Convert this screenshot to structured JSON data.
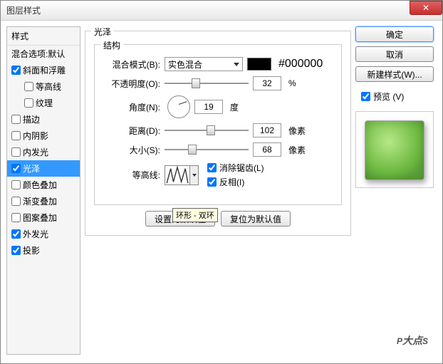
{
  "window": {
    "title": "图层样式"
  },
  "sidebar": {
    "header": "样式",
    "blendOptions": "混合选项:默认",
    "items": [
      {
        "label": "斜面和浮雕",
        "checked": true,
        "indent": false
      },
      {
        "label": "等高线",
        "checked": false,
        "indent": true
      },
      {
        "label": "纹理",
        "checked": false,
        "indent": true
      },
      {
        "label": "描边",
        "checked": false,
        "indent": false
      },
      {
        "label": "内阴影",
        "checked": false,
        "indent": false
      },
      {
        "label": "内发光",
        "checked": false,
        "indent": false
      },
      {
        "label": "光泽",
        "checked": true,
        "indent": false,
        "selected": true
      },
      {
        "label": "颜色叠加",
        "checked": false,
        "indent": false
      },
      {
        "label": "渐变叠加",
        "checked": false,
        "indent": false
      },
      {
        "label": "图案叠加",
        "checked": false,
        "indent": false
      },
      {
        "label": "外发光",
        "checked": true,
        "indent": false
      },
      {
        "label": "投影",
        "checked": true,
        "indent": false
      }
    ]
  },
  "panel": {
    "title": "光泽",
    "section": "结构",
    "blendModeLabel": "混合模式(B):",
    "blendModeValue": "实色混合",
    "colorHex": "#000000",
    "opacityLabel": "不透明度(O):",
    "opacityValue": "32",
    "opacityUnit": "%",
    "angleLabel": "角度(N):",
    "angleValue": "19",
    "angleUnit": "度",
    "distanceLabel": "距离(D):",
    "distanceValue": "102",
    "distanceUnit": "像素",
    "sizeLabel": "大小(S):",
    "sizeValue": "68",
    "sizeUnit": "像素",
    "contourLabel": "等高线:",
    "antiAliasLabel": "消除锯齿(L)",
    "invertLabel": "反相(I)",
    "btnDefault": "设置为默认值",
    "btnReset": "复位为默认值",
    "tooltip": "环形 - 双环"
  },
  "right": {
    "ok": "确定",
    "cancel": "取消",
    "newStyle": "新建样式(W)...",
    "previewLabel": "预览 (V)"
  },
  "watermark": {
    "big": "P",
    "small": "大点",
    "s": "S"
  }
}
